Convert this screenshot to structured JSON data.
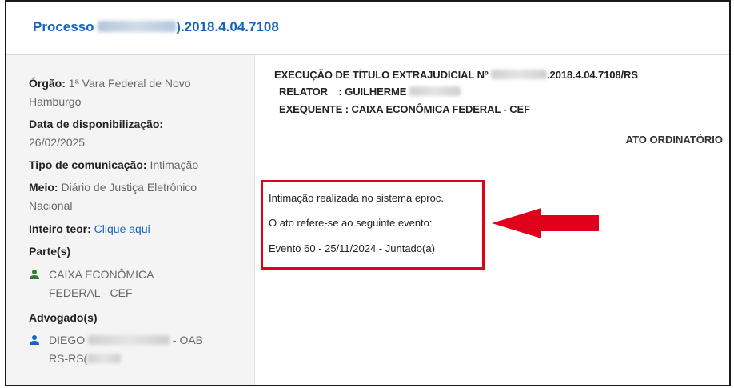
{
  "header": {
    "title_prefix": "Processo",
    "title_suffix": ").2018.4.04.7108"
  },
  "sidebar": {
    "orgao_label": "Órgão:",
    "orgao_value_line1": "1ª Vara Federal de Novo",
    "orgao_value_line2": "Hamburgo",
    "data_label": "Data de disponibilização:",
    "data_value": "26/02/2025",
    "tipo_label": "Tipo de comunicação:",
    "tipo_value": "Intimação",
    "meio_label": "Meio:",
    "meio_value_line1": "Diário de Justiça Eletrônico",
    "meio_value_line2": "Nacional",
    "inteiro_label": "Inteiro teor:",
    "inteiro_link": "Clique aqui",
    "partes_label": "Parte(s)",
    "parte_line1": "CAIXA ECONÔMICA",
    "parte_line2": "FEDERAL - CEF",
    "advogados_label": "Advogado(s)",
    "advogado_name": "DIEGO",
    "advogado_oab": "- OAB",
    "advogado_line2": "RS-RS("
  },
  "document": {
    "line1_prefix": "EXECUÇÃO DE TÍTULO EXTRAJUDICIAL Nº",
    "line1_suffix": ".2018.4.04.7108/RS",
    "relator_label": "RELATOR",
    "relator_value": ": GUILHERME",
    "exequente": "EXEQUENTE : CAIXA ECONÔMICA FEDERAL - CEF",
    "ato": "ATO ORDINATÓRIO",
    "msg1": "Intimação realizada no sistema eproc.",
    "msg2": "O ato refere-se ao seguinte evento:",
    "msg3": "Evento 60 - 25/11/2024 - Juntado(a)"
  },
  "colors": {
    "link": "#1565c0",
    "highlight_box": "#e0001b",
    "arrow": "#e0001b",
    "sidebar_bg": "#f4f4f4",
    "party_icon": "#2e7d32",
    "lawyer_icon": "#1565c0"
  },
  "icons": {
    "party": "person-icon",
    "lawyer": "person-icon",
    "annotation": "left-arrow-icon"
  }
}
